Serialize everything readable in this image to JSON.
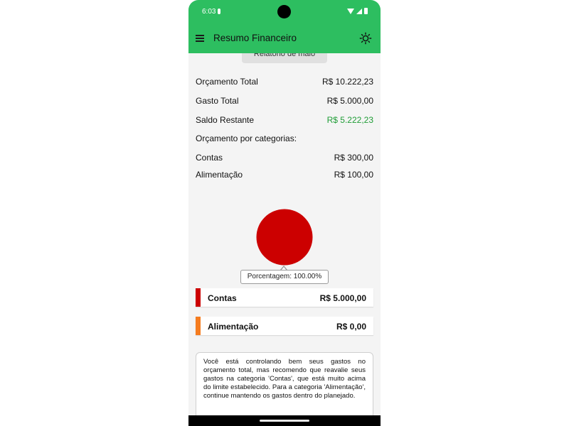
{
  "status_bar": {
    "time": "6:03"
  },
  "app_bar": {
    "title": "Resumo Financeiro",
    "menu_icon": "menu-icon",
    "theme_icon": "sun-icon"
  },
  "report_button": {
    "label": "Relatório de maio"
  },
  "summary": {
    "total_budget": {
      "label": "Orçamento Total",
      "value": "R$ 10.222,23"
    },
    "total_spent": {
      "label": "Gasto Total",
      "value": "R$ 5.000,00"
    },
    "remaining": {
      "label": "Saldo Restante",
      "value": "R$ 5.222,23",
      "color": "#1f9d36"
    }
  },
  "category_budget": {
    "heading": "Orçamento por categorias:",
    "items": [
      {
        "label": "Contas",
        "value": "R$ 300,00"
      },
      {
        "label": "Alimentação",
        "value": "R$ 100,00"
      }
    ]
  },
  "chart_data": {
    "type": "pie",
    "categories": [
      "Contas",
      "Alimentação"
    ],
    "values": [
      100.0,
      0.0
    ],
    "colors": [
      "#cc0000",
      "#f57c1f"
    ],
    "tooltip": "Porcentagem: 100.00%"
  },
  "spending_cards": [
    {
      "label": "Contas",
      "value": "R$ 5.000,00",
      "color": "#cc0000"
    },
    {
      "label": "Alimentação",
      "value": "R$ 0,00",
      "color": "#f57c1f"
    }
  ],
  "advice": "Você está controlando bem seus gastos no orçamento total, mas recomendo que reavalie seus gastos na categoria 'Contas', que está muito acima do limite estabelecido. Para a categoria 'Alimentação', continue mantendo os gastos dentro do planejado.",
  "colors": {
    "primary": "#2dbe60",
    "background": "#f4f4f4"
  }
}
